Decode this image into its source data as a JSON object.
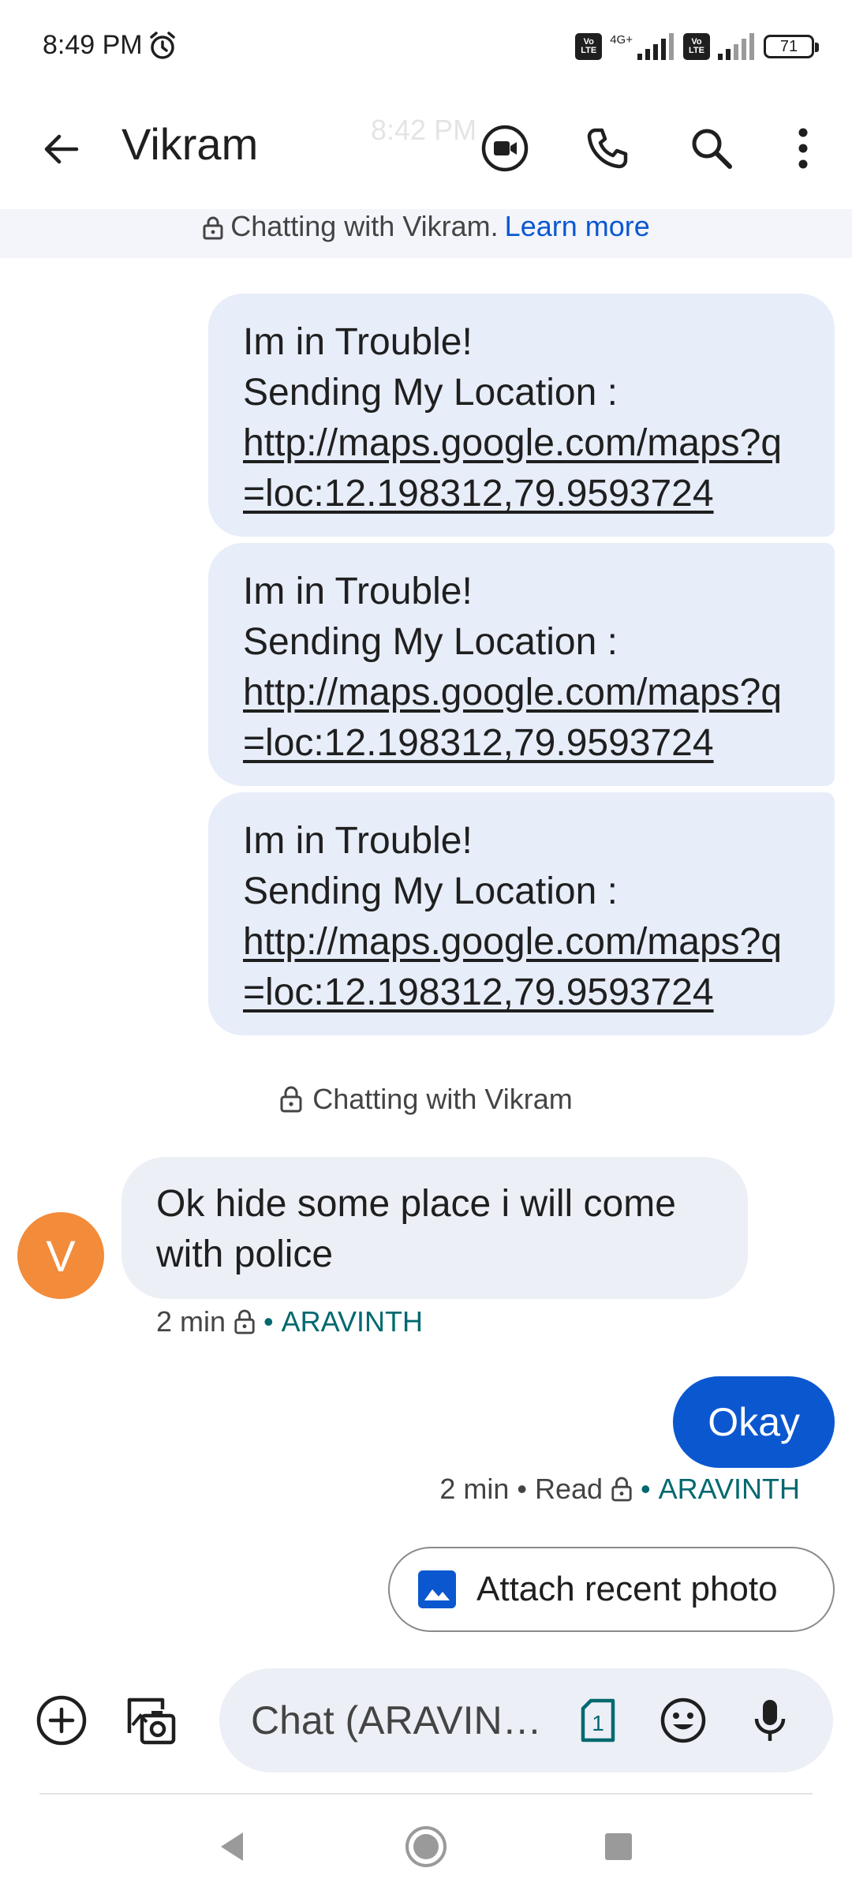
{
  "status_bar": {
    "time": "8:49 PM",
    "network_type": "4G+",
    "battery": "71",
    "volte_label_top": "Vo",
    "volte_label_bottom": "LTE"
  },
  "app_bar": {
    "contact_name": "Vikram",
    "ghost_time": "8:42 PM"
  },
  "banner": {
    "text": "Chatting with Vikram.",
    "link": "Learn more"
  },
  "outgoing_messages": [
    {
      "line1": "Im in Trouble!",
      "line2": "Sending My Location :",
      "link": "http://maps.google.com/maps?q=loc:12.198312,79.9593724"
    },
    {
      "line1": "Im in Trouble!",
      "line2": "Sending My Location :",
      "link": "http://maps.google.com/maps?q=loc:12.198312,79.9593724"
    },
    {
      "line1": "Im in Trouble!",
      "line2": "Sending My Location :",
      "link": "http://maps.google.com/maps?q=loc:12.198312,79.9593724"
    }
  ],
  "system_note": "Chatting with Vikram",
  "incoming_message": {
    "avatar_letter": "V",
    "text": "Ok hide some place i will come with police",
    "time": "2 min",
    "separator": "•",
    "sender": "ARAVINTH"
  },
  "my_reply": {
    "text": "Okay",
    "time": "2 min",
    "status": "Read",
    "separator": "•",
    "sender": "ARAVINTH"
  },
  "attach_chip": {
    "label": "Attach recent photo"
  },
  "compose": {
    "placeholder": "Chat (ARAVIN…",
    "sim_number": "1"
  },
  "colors": {
    "accent": "#0b57d0",
    "outgoing_bubble": "#e7edf9",
    "incoming_bubble": "#eceff6",
    "avatar": "#f28b3a",
    "sender": "#00696f"
  }
}
